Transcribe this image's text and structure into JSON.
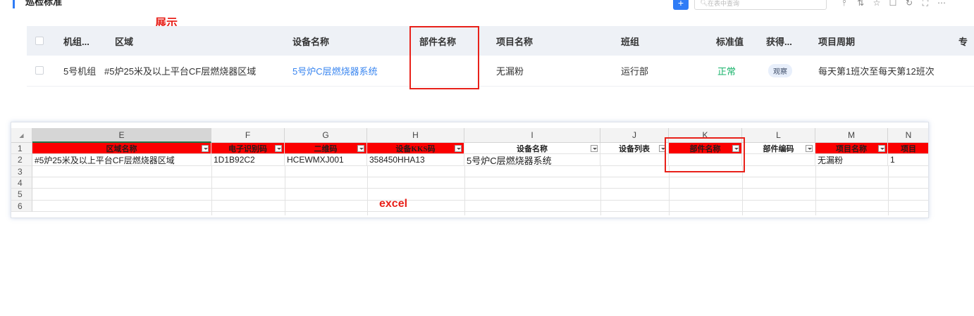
{
  "header": {
    "title": "巡检标准",
    "add_label": "+",
    "search_placeholder": "在表中查询",
    "tools": [
      "filter-icon",
      "sort-icon",
      "star-icon",
      "copy-icon",
      "refresh-icon",
      "fullscreen-icon",
      "more-icon"
    ]
  },
  "annotations": {
    "show_label": "展示",
    "excel_label": "excel"
  },
  "top_table": {
    "columns": [
      "机组...",
      "区域",
      "设备名称",
      "部件名称",
      "项目名称",
      "班组",
      "标准值",
      "获得...",
      "项目周期",
      "专"
    ],
    "row": {
      "unit": "5号机组",
      "area": "#5炉25米及以上平台CF层燃烧器区域",
      "device_name": "5号炉C层燃烧器系统",
      "part_name": "",
      "item_name": "无漏粉",
      "team": "运行部",
      "standard_value": "正常",
      "obtain_method": "观察",
      "cycle": "每天第1班次至每天第12班次"
    }
  },
  "excel": {
    "corner": "◢",
    "columns": [
      "E",
      "F",
      "G",
      "H",
      "I",
      "J",
      "K",
      "L",
      "M",
      "N"
    ],
    "row_numbers": [
      "1",
      "2",
      "3",
      "4",
      "5",
      "6"
    ],
    "headers": [
      "区域名称",
      "电子识别码",
      "二维码",
      "设备KKS码",
      "设备名称",
      "设备列表",
      "部件名称",
      "部件编码",
      "项目名称",
      "项目"
    ],
    "row2": [
      "#5炉25米及以上平台CF层燃烧器区域",
      "1D1B92C2",
      "HCEWMXJ001",
      "358450HHA13",
      "5号炉C层燃烧器系统",
      "",
      "",
      "",
      "无漏粉",
      "1"
    ]
  },
  "colors": {
    "accent": "#2f7cf6",
    "excel_header_red": "#fb0000",
    "annotation_red": "#e8211a",
    "status_green": "#19b36b"
  }
}
